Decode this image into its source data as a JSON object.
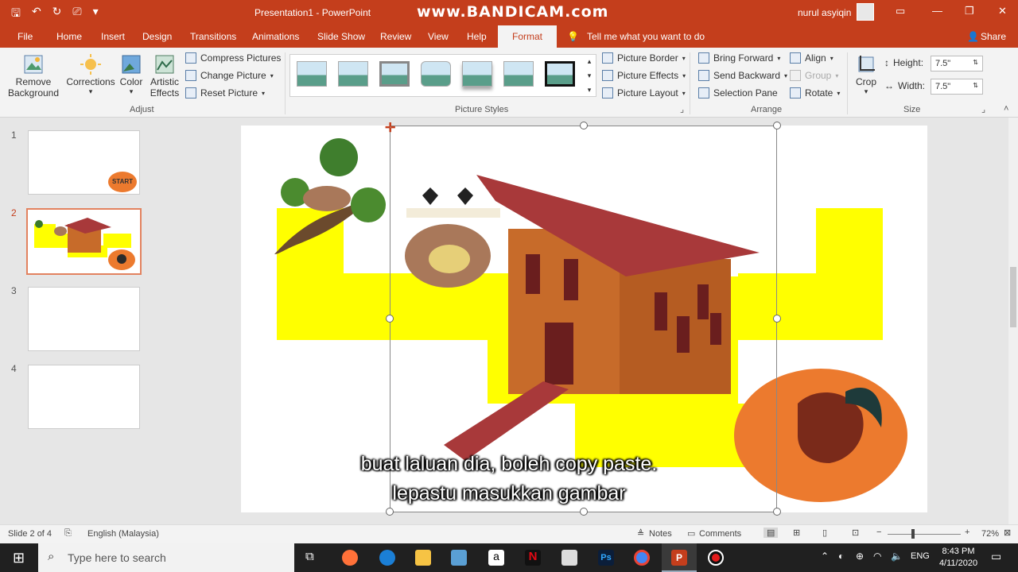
{
  "app": {
    "window_title": "Presentation1  -  PowerPoint",
    "watermark": "www.BANDICAM.com",
    "user_name": "nurul asyiqin",
    "accent_color": "#c43e1c"
  },
  "tabs": [
    {
      "label": "File"
    },
    {
      "label": "Home"
    },
    {
      "label": "Insert"
    },
    {
      "label": "Design"
    },
    {
      "label": "Transitions"
    },
    {
      "label": "Animations"
    },
    {
      "label": "Slide Show"
    },
    {
      "label": "Review"
    },
    {
      "label": "View"
    },
    {
      "label": "Help"
    },
    {
      "label": "Format"
    }
  ],
  "tell_me": "Tell me what you want to do",
  "share": "Share",
  "ribbon": {
    "remove_background": "Remove Background",
    "corrections": "Corrections",
    "color": "Color",
    "artistic_effects": "Artistic Effects",
    "compress_pictures": "Compress Pictures",
    "change_picture": "Change Picture",
    "reset_picture": "Reset Picture",
    "group_adjust": "Adjust",
    "group_picture_styles": "Picture Styles",
    "picture_border": "Picture Border",
    "picture_effects": "Picture Effects",
    "picture_layout": "Picture Layout",
    "bring_forward": "Bring Forward",
    "send_backward": "Send Backward",
    "selection_pane": "Selection Pane",
    "align": "Align",
    "group": "Group",
    "rotate": "Rotate",
    "group_arrange": "Arrange",
    "crop": "Crop",
    "height_label": "Height:",
    "height_value": "7.5\"",
    "width_label": "Width:",
    "width_value": "7.5\"",
    "group_size": "Size"
  },
  "slides": [
    {
      "num": "1",
      "start_label": "START"
    },
    {
      "num": "2"
    },
    {
      "num": "3"
    },
    {
      "num": "4"
    }
  ],
  "subtitles": {
    "line1": "buat laluan dia, boleh copy paste.",
    "line2": "lepastu masukkan gambar"
  },
  "status": {
    "slide_of": "Slide 2 of 4",
    "language": "English (Malaysia)",
    "notes": "Notes",
    "comments": "Comments",
    "zoom": "72%"
  },
  "taskbar": {
    "search_placeholder": "Type here to search",
    "lang": "ENG",
    "time": "8:43 PM",
    "date": "4/11/2020"
  }
}
